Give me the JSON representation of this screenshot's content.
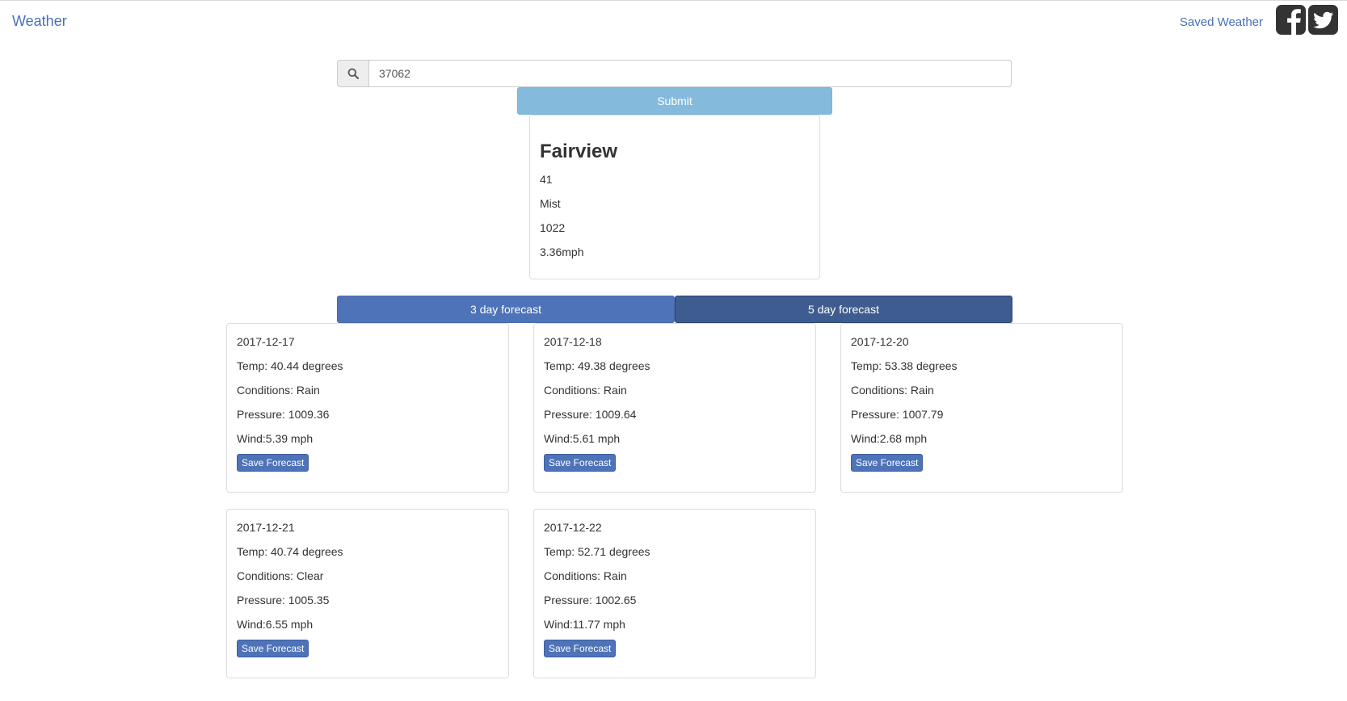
{
  "navbar": {
    "brand": "Weather",
    "saved_link": "Saved Weather",
    "social_icons": [
      "facebook-icon",
      "twitter-icon"
    ]
  },
  "search": {
    "icon": "search-icon",
    "value": "37062",
    "submit_label": "Submit"
  },
  "current": {
    "city": "Fairview",
    "temp": "41",
    "conditions": "Mist",
    "pressure": "1022",
    "wind": "3.36mph"
  },
  "tabs": {
    "three_day": "3 day forecast",
    "five_day": "5 day forecast"
  },
  "forecast": [
    {
      "date": "2017-12-17",
      "temp": "Temp: 40.44 degrees",
      "conditions": "Conditions: Rain",
      "pressure": "Pressure: 1009.36",
      "wind": "Wind:5.39 mph",
      "save_label": "Save Forecast"
    },
    {
      "date": "2017-12-18",
      "temp": "Temp: 49.38 degrees",
      "conditions": "Conditions: Rain",
      "pressure": "Pressure: 1009.64",
      "wind": "Wind:5.61 mph",
      "save_label": "Save Forecast"
    },
    {
      "date": "2017-12-20",
      "temp": "Temp: 53.38 degrees",
      "conditions": "Conditions: Rain",
      "pressure": "Pressure: 1007.79",
      "wind": "Wind:2.68 mph",
      "save_label": "Save Forecast"
    },
    {
      "date": "2017-12-21",
      "temp": "Temp: 40.74 degrees",
      "conditions": "Conditions: Clear",
      "pressure": "Pressure: 1005.35",
      "wind": "Wind:6.55 mph",
      "save_label": "Save Forecast"
    },
    {
      "date": "2017-12-22",
      "temp": "Temp: 52.71 degrees",
      "conditions": "Conditions: Rain",
      "pressure": "Pressure: 1002.65",
      "wind": "Wind:11.77 mph",
      "save_label": "Save Forecast"
    }
  ],
  "colors": {
    "link": "#4a6fb5",
    "submit": "#84bbdd",
    "tab_active": "#4e73b8",
    "tab_dark": "#3f5c90"
  }
}
